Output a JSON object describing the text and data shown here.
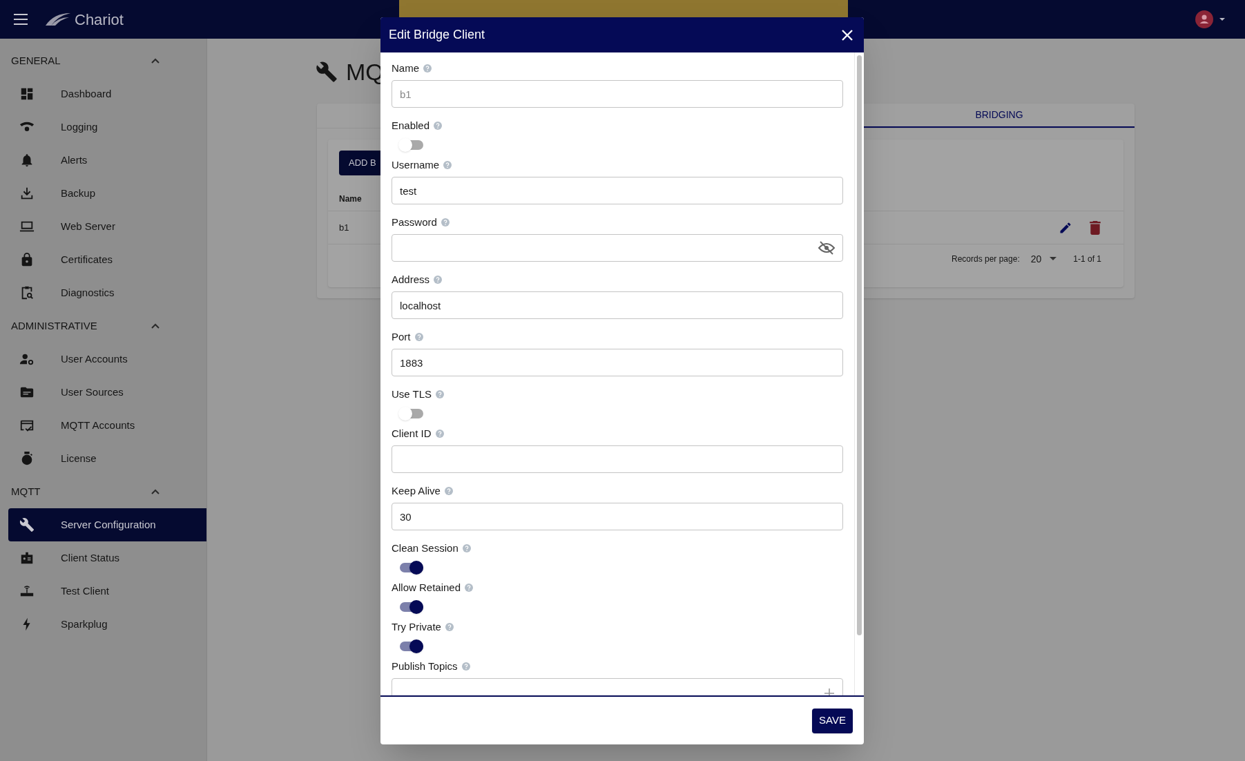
{
  "app_bar": {
    "brand": "Chariot"
  },
  "sidebar": {
    "sections": [
      {
        "title": "GENERAL",
        "expanded": true,
        "items": [
          {
            "label": "Dashboard",
            "selected": false
          },
          {
            "label": "Logging",
            "selected": false
          },
          {
            "label": "Alerts",
            "selected": false
          },
          {
            "label": "Backup",
            "selected": false
          },
          {
            "label": "Web Server",
            "selected": false
          },
          {
            "label": "Certificates",
            "selected": false
          },
          {
            "label": "Diagnostics",
            "selected": false
          }
        ]
      },
      {
        "title": "ADMINISTRATIVE",
        "expanded": true,
        "items": [
          {
            "label": "User Accounts",
            "selected": false
          },
          {
            "label": "User Sources",
            "selected": false
          },
          {
            "label": "MQTT Accounts",
            "selected": false
          },
          {
            "label": "License",
            "selected": false
          }
        ]
      },
      {
        "title": "MQTT",
        "expanded": true,
        "items": [
          {
            "label": "Server Configuration",
            "selected": true
          },
          {
            "label": "Client Status",
            "selected": false
          },
          {
            "label": "Test Client",
            "selected": false
          },
          {
            "label": "Sparkplug",
            "selected": false
          }
        ]
      }
    ]
  },
  "page": {
    "title": "MQ",
    "tabs": [
      {
        "label": "BRIDGING",
        "selected": true
      }
    ],
    "add_button": "ADD B",
    "table": {
      "columns": [
        "Name"
      ],
      "rows": [
        [
          "b1"
        ]
      ]
    },
    "footer": {
      "records_label": "Records per page:",
      "per_page": "20",
      "range": "1-1 of 1"
    }
  },
  "dialog": {
    "title": "Edit Bridge Client",
    "save": "SAVE",
    "fields": [
      {
        "kind": "text",
        "label": "Name",
        "value": "b1",
        "disabled": true
      },
      {
        "kind": "toggle",
        "label": "Enabled",
        "on": false
      },
      {
        "kind": "text",
        "label": "Username",
        "value": "test",
        "disabled": false
      },
      {
        "kind": "password",
        "label": "Password"
      },
      {
        "kind": "text",
        "label": "Address",
        "value": "localhost",
        "disabled": false
      },
      {
        "kind": "text",
        "label": "Port",
        "value": "1883",
        "disabled": false
      },
      {
        "kind": "toggle",
        "label": "Use TLS",
        "on": false
      },
      {
        "kind": "text",
        "label": "Client ID"
      },
      {
        "kind": "text",
        "label": "Keep Alive",
        "value": "30",
        "disabled": false
      },
      {
        "kind": "toggle",
        "label": "Clean Session",
        "on": true
      },
      {
        "kind": "toggle",
        "label": "Allow Retained",
        "on": true
      },
      {
        "kind": "toggle",
        "label": "Try Private",
        "on": true
      },
      {
        "kind": "list",
        "label": "Publish Topics"
      }
    ]
  }
}
